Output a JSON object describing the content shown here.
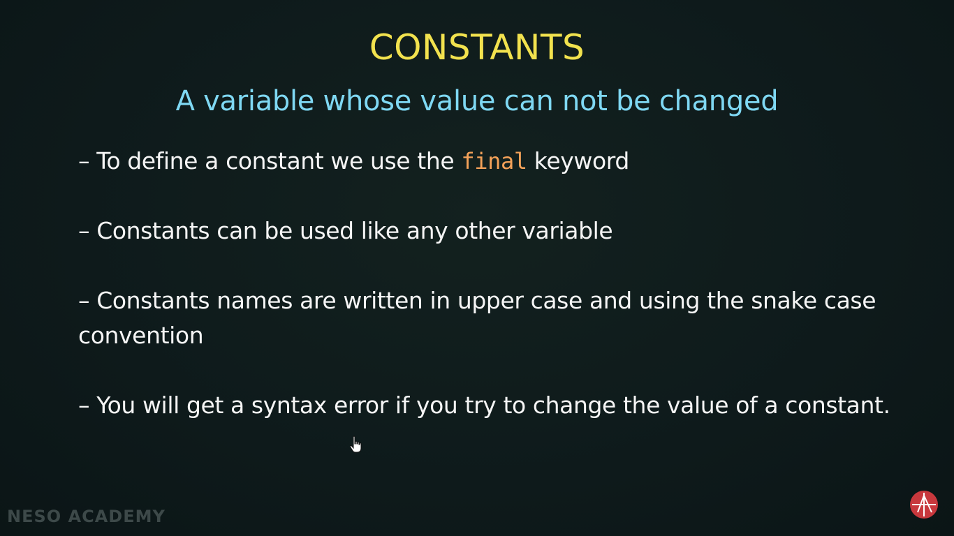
{
  "slide": {
    "title": "CONSTANTS",
    "subtitle": "A variable whose value can not be changed",
    "bullets": [
      {
        "prefix": "– To define a constant we use the ",
        "keyword": "final",
        "suffix": " keyword"
      },
      {
        "text": "– Constants can be used like any other variable"
      },
      {
        "text": "– Constants names are written in upper case and using the snake case convention"
      },
      {
        "text": "– You will get a syntax error if you try to change the value of a constant."
      }
    ]
  },
  "branding": {
    "watermark": "NESO ACADEMY",
    "logo_icon": "neso-academy-logo-icon"
  },
  "colors": {
    "background": "#0f1b1d",
    "title": "#f2e24e",
    "subtitle": "#7fd8f3",
    "body_text": "#f5f5f5",
    "keyword": "#f4a259",
    "logo_red": "#c8383d",
    "watermark": "#3d4949"
  }
}
